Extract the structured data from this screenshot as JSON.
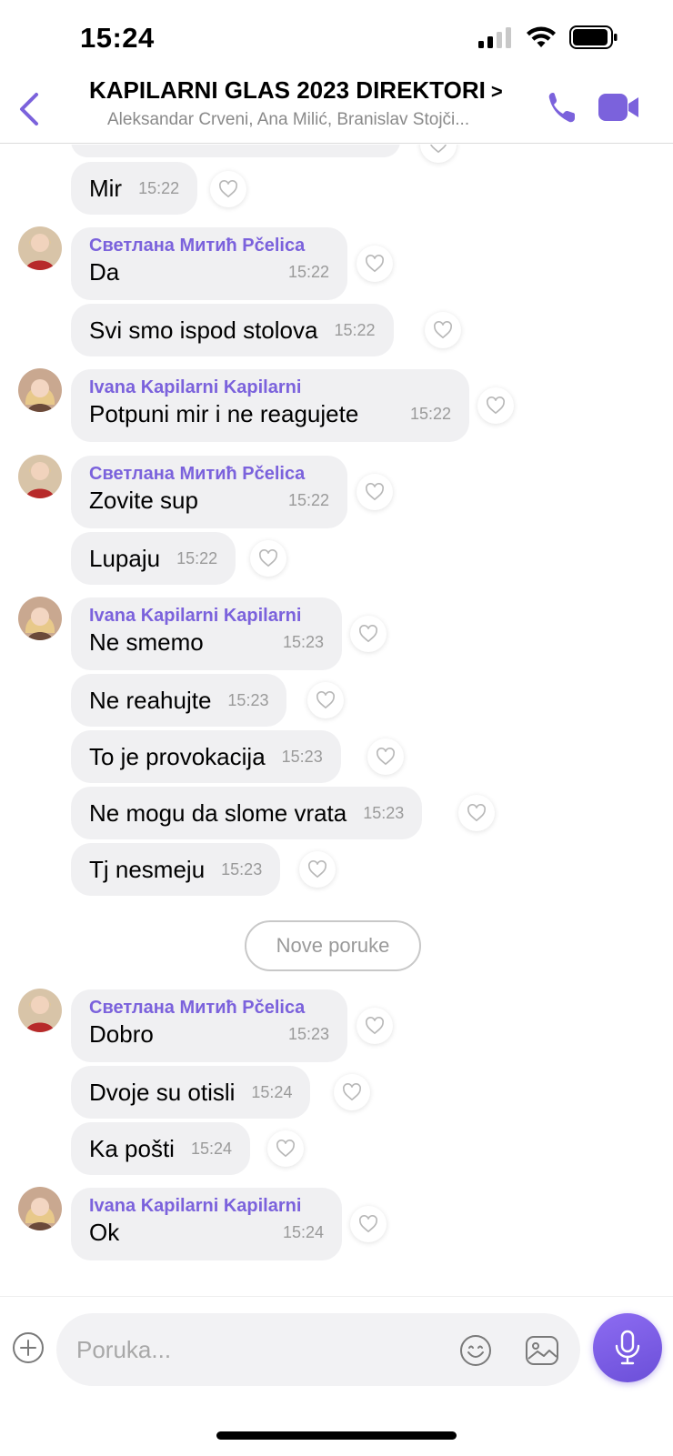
{
  "status_bar": {
    "time": "15:24"
  },
  "header": {
    "title": "KAPILARNI GLAS 2023 DIREKTORI",
    "title_chevron": ">",
    "subtitle": "Aleksandar Crveni, Ana Milić, Branislav Stojči...",
    "accent_color": "#7b62dc"
  },
  "messages": [
    {
      "text": "Mir",
      "time": "15:22"
    },
    {
      "sender": "Светлана Митић Pčelica",
      "text": "Da",
      "time": "15:22"
    },
    {
      "text": "Svi smo ispod stolova",
      "time": "15:22"
    },
    {
      "sender": "Ivana Kapilarni Kapilarni",
      "text": "Potpuni mir i ne reagujete",
      "time": "15:22"
    },
    {
      "sender": "Светлана Митић Pčelica",
      "text": "Zovite sup",
      "time": "15:22"
    },
    {
      "text": "Lupaju",
      "time": "15:22"
    },
    {
      "sender": "Ivana Kapilarni Kapilarni",
      "text": "Ne smemo",
      "time": "15:23"
    },
    {
      "text": "Ne reahujte",
      "time": "15:23"
    },
    {
      "text": "To je provokacija",
      "time": "15:23"
    },
    {
      "text": "Ne mogu da slome vrata",
      "time": "15:23"
    },
    {
      "text": "Tj nesmeju",
      "time": "15:23"
    },
    {
      "sender": "Светлана Митић Pčelica",
      "text": "Dobro",
      "time": "15:23"
    },
    {
      "text": "Dvoje su otisli",
      "time": "15:24"
    },
    {
      "text": "Ka pošti",
      "time": "15:24"
    },
    {
      "sender": "Ivana Kapilarni Kapilarni",
      "text": "Ok",
      "time": "15:24"
    }
  ],
  "new_messages_label": "Nove poruke",
  "composer": {
    "placeholder": "Poruka..."
  }
}
